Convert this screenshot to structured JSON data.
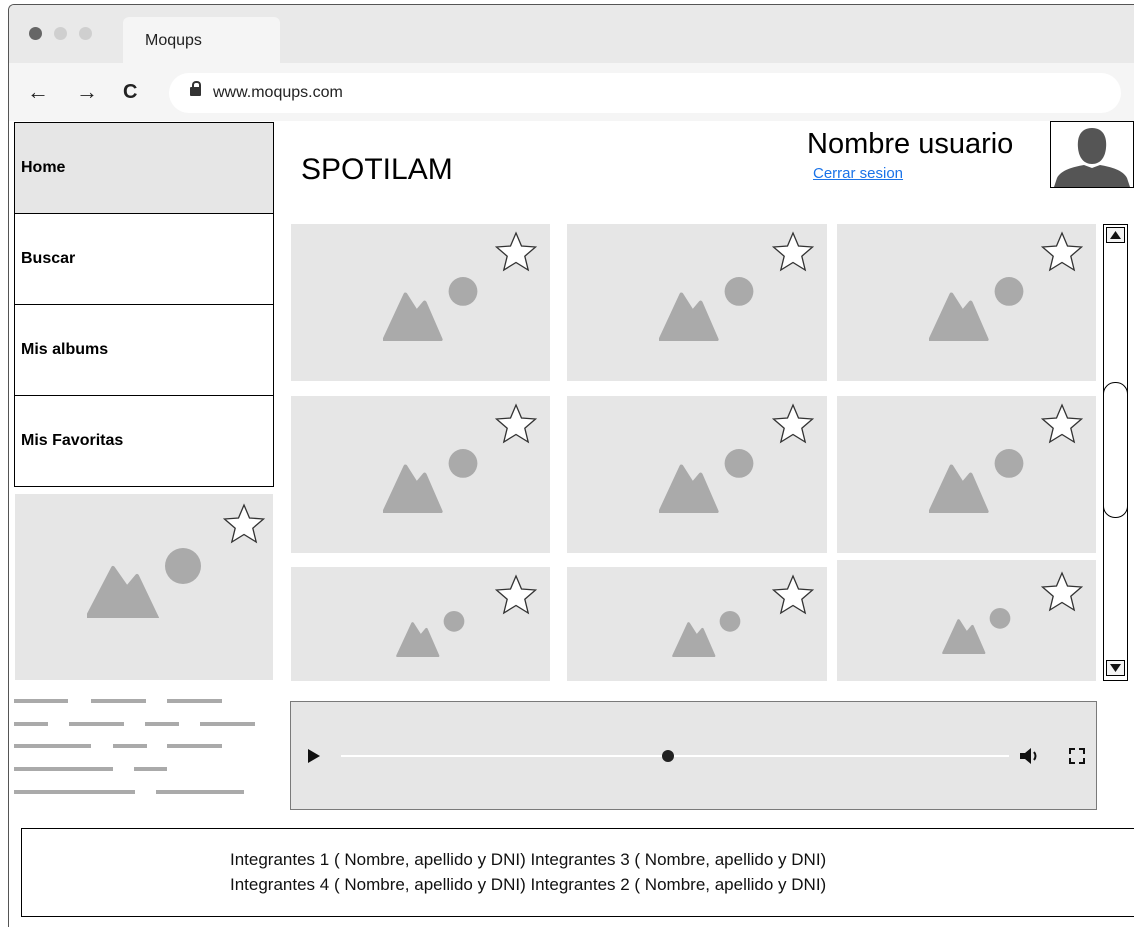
{
  "browser": {
    "tab_title": "Moqups",
    "url": "www.moqups.com",
    "window_dot_colors": [
      "#666666",
      "#cfcfcf",
      "#cfcfcf"
    ]
  },
  "sidebar": {
    "items": [
      {
        "label": "Home",
        "active": true
      },
      {
        "label": "Buscar",
        "active": false
      },
      {
        "label": "Mis albums",
        "active": false
      },
      {
        "label": "Mis Favoritas",
        "active": false
      }
    ]
  },
  "header": {
    "app_title": "SPOTILAM",
    "user_name": "Nombre usuario",
    "logout_label": "Cerrar sesion"
  },
  "footer": {
    "line1": "Integrantes 1 ( Nombre, apellido y DNI) Integrantes 3 ( Nombre, apellido y DNI)",
    "line2": "Integrantes 4 ( Nombre, apellido y DNI) Integrantes 2 ( Nombre, apellido y DNI)"
  },
  "player": {
    "progress": 0.49
  },
  "colors": {
    "placeholder_bg": "#e6e6e6",
    "placeholder_icon": "#aaaaaa",
    "link": "#1a73e8"
  },
  "icons": {
    "back": "arrow-left-icon",
    "forward": "arrow-right-icon",
    "reload": "reload-icon",
    "lock": "lock-icon",
    "favorite": "star-outline-icon",
    "image": "image-placeholder-icon",
    "play": "play-icon",
    "volume": "volume-icon",
    "fullscreen": "fullscreen-icon",
    "avatar": "user-silhouette-icon"
  }
}
